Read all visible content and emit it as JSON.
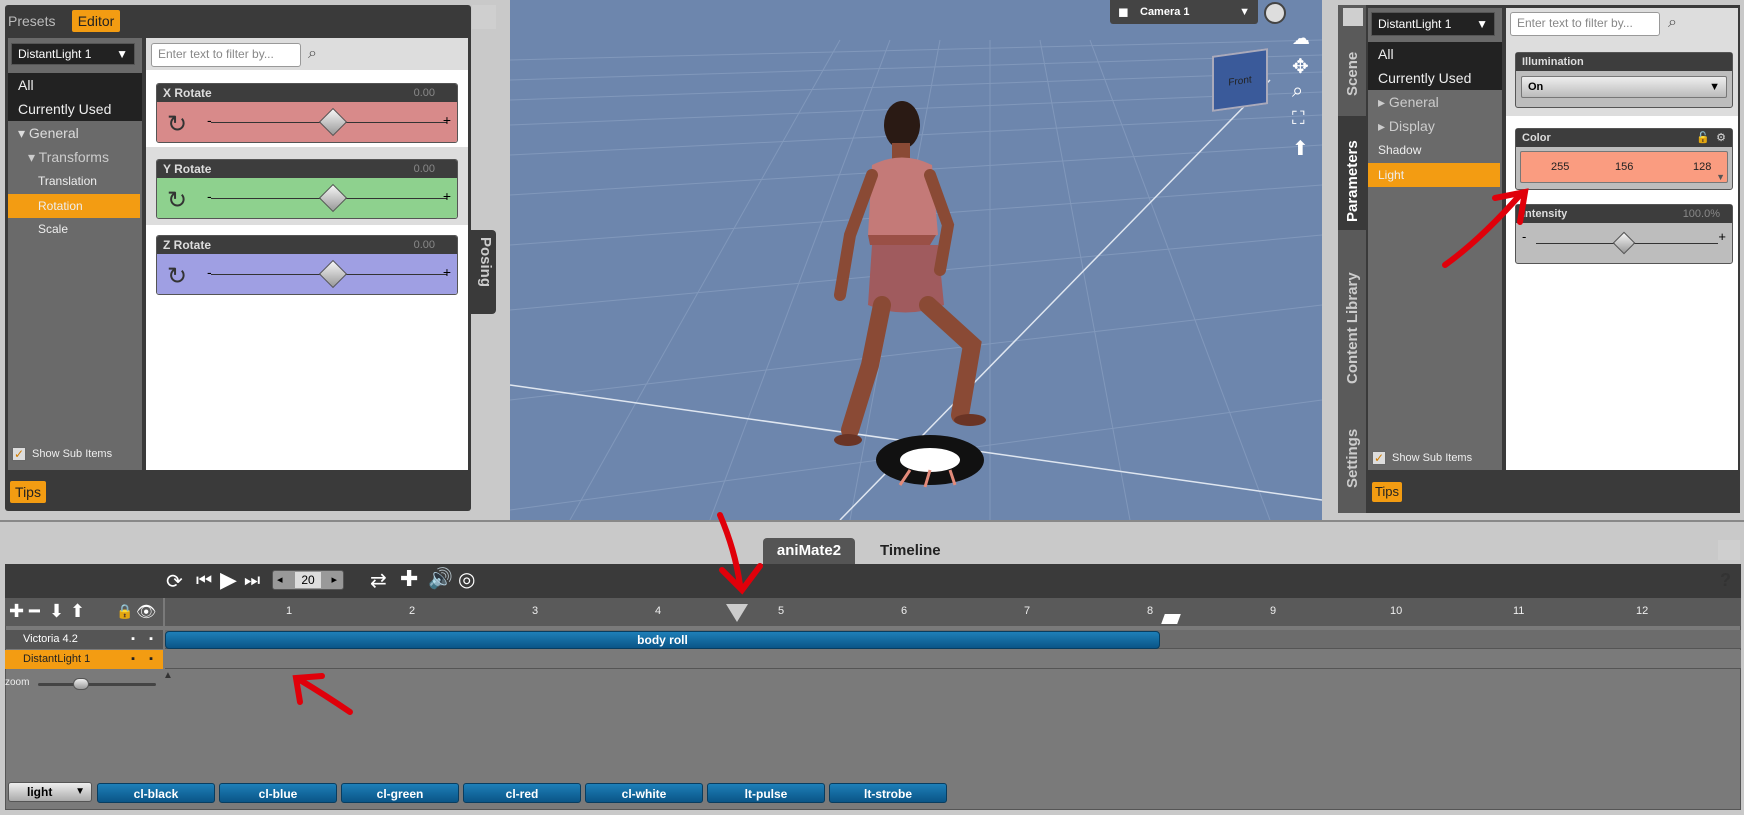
{
  "left_panel": {
    "tabs": [
      "Presets",
      "Editor"
    ],
    "node_select": "DistantLight 1",
    "filter_placeholder": "Enter text to filter by...",
    "tree": [
      "All",
      "Currently Used",
      "General",
      "Transforms",
      "Translation",
      "Rotation",
      "Scale"
    ],
    "show_sub_items": "Show Sub Items",
    "tips": "Tips",
    "side_tab": "Posing",
    "sliders": [
      {
        "label": "X Rotate",
        "value": "0.00",
        "color": "#d88a8a"
      },
      {
        "label": "Y Rotate",
        "value": "0.00",
        "color": "#8ed18e"
      },
      {
        "label": "Z Rotate",
        "value": "0.00",
        "color": "#9f9fe3"
      }
    ],
    "minus": "-",
    "plus": "+"
  },
  "viewport": {
    "camera": "Camera 1",
    "cube_label": "Front"
  },
  "right_panel": {
    "node_select": "DistantLight 1",
    "filter_placeholder": "Enter text to filter by...",
    "side_tabs": [
      "Scene",
      "Parameters",
      "Content Library",
      "Settings"
    ],
    "tree": [
      "All",
      "Currently Used",
      "General",
      "Display",
      "Shadow",
      "Light"
    ],
    "illumination": {
      "label": "Illumination",
      "value": "On"
    },
    "color": {
      "label": "Color",
      "r": "255",
      "g": "156",
      "b": "128",
      "swatch": "#fa9c80"
    },
    "intensity": {
      "label": "Intensity",
      "value": "100.0%"
    },
    "show_sub_items": "Show Sub Items",
    "tips": "Tips"
  },
  "bottom": {
    "tabs": [
      "aniMate2",
      "Timeline"
    ],
    "frame_value": "20",
    "help": "?",
    "ruler": [
      "1",
      "2",
      "3",
      "4",
      "5",
      "6",
      "7",
      "8",
      "9",
      "10",
      "11",
      "12"
    ],
    "tracks": [
      {
        "name": "Victoria 4.2"
      },
      {
        "name": "DistantLight 1"
      }
    ],
    "clip_label": "body roll",
    "zoom_label": "zoom",
    "category": "light",
    "presets": [
      "cl-black",
      "cl-blue",
      "cl-green",
      "cl-red",
      "cl-white",
      "lt-pulse",
      "lt-strobe"
    ]
  }
}
